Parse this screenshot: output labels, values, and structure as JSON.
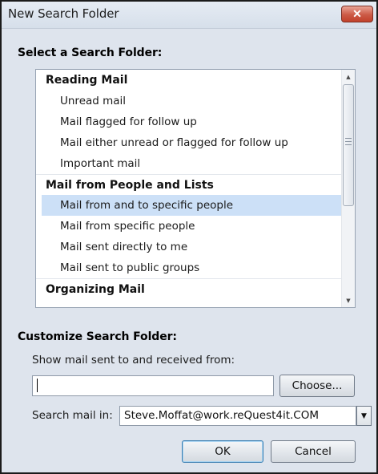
{
  "window": {
    "title": "New Search Folder",
    "close_glyph": "✕"
  },
  "select_section": {
    "label": "Select a Search Folder:",
    "groups": [
      {
        "header": "Reading Mail",
        "items": [
          "Unread mail",
          "Mail flagged for follow up",
          "Mail either unread or flagged for follow up",
          "Important mail"
        ]
      },
      {
        "header": "Mail from People and Lists",
        "items": [
          "Mail from and to specific people",
          "Mail from specific people",
          "Mail sent directly to me",
          "Mail sent to public groups"
        ]
      },
      {
        "header": "Organizing Mail",
        "items": []
      }
    ],
    "selected_item": "Mail from and to specific people"
  },
  "customize_section": {
    "label": "Customize Search Folder:",
    "show_mail_label": "Show mail sent to and received from:",
    "people_input_value": "",
    "choose_button": "Choose...",
    "search_in_label": "Search mail in:",
    "search_in_value": "Steve.Moffat@work.reQuest4it.COM"
  },
  "footer": {
    "ok_button": "OK",
    "cancel_button": "Cancel"
  },
  "icons": {
    "scroll_up": "▲",
    "scroll_down": "▼",
    "combo_down": "▼"
  },
  "colors": {
    "dialog_background": "#dee4ed",
    "selection_highlight": "#cce0f7",
    "close_button": "#c94f3b"
  }
}
